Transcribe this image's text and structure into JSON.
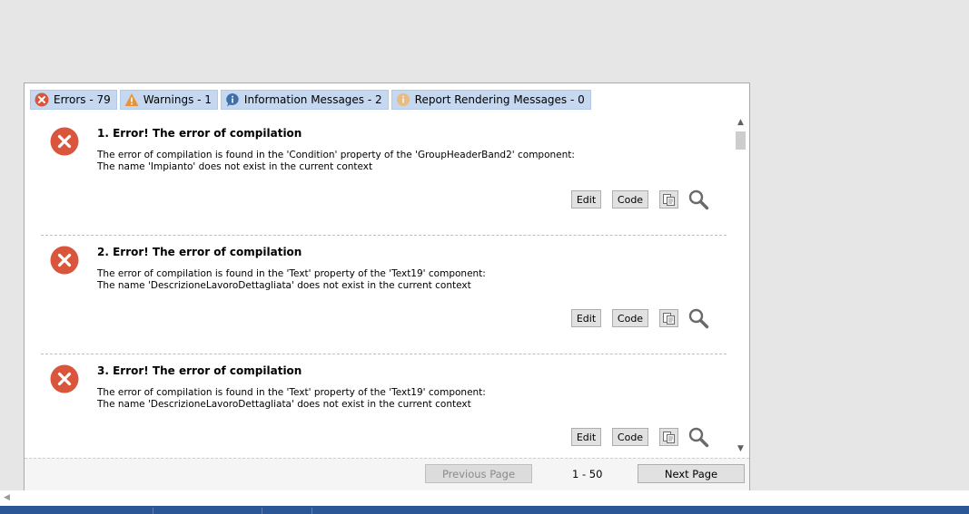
{
  "tabs": [
    {
      "label": "Errors - 79",
      "icon": "error-icon"
    },
    {
      "label": "Warnings - 1",
      "icon": "warning-icon"
    },
    {
      "label": "Information Messages - 2",
      "icon": "info-icon"
    },
    {
      "label": "Report Rendering Messages - 0",
      "icon": "report-rendering-icon"
    }
  ],
  "messages": [
    {
      "title": "1. Error! The error of compilation",
      "line1": "The error of compilation is found in the 'Condition' property of the 'GroupHeaderBand2' component:",
      "line2": "The name 'Impianto' does not exist in the current context"
    },
    {
      "title": "2. Error! The error of compilation",
      "line1": "The error of compilation is found in the 'Text' property of the 'Text19' component:",
      "line2": "The name 'DescrizioneLavoroDettagliata' does not exist in the current context"
    },
    {
      "title": "3. Error! The error of compilation",
      "line1": "The error of compilation is found in the 'Text' property of the 'Text19' component:",
      "line2": "The name 'DescrizioneLavoroDettagliata' does not exist in the current context"
    }
  ],
  "buttons": {
    "edit": "Edit",
    "code": "Code"
  },
  "pager": {
    "previous": "Previous Page",
    "range": "1 - 50",
    "next": "Next Page"
  },
  "colors": {
    "error": "#d9553c",
    "tab_bg": "#c5d8f0",
    "taskbar": "#2b5797"
  }
}
